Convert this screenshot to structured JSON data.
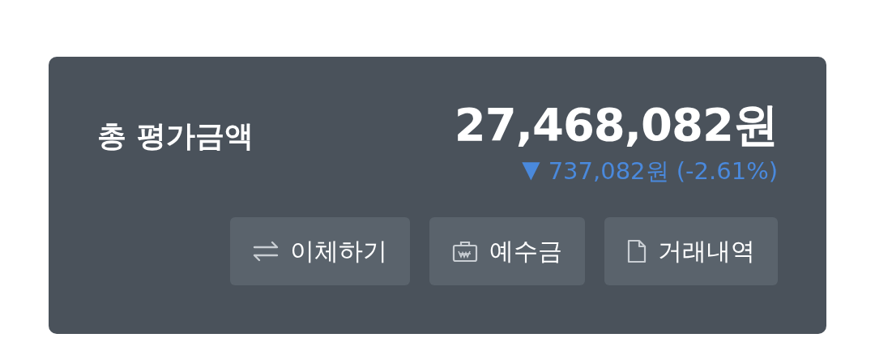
{
  "summary": {
    "title": "총 평가금액",
    "amount": "27,468,082원",
    "change": {
      "arrow": "▼",
      "text": "737,082원 (-2.61%)"
    }
  },
  "buttons": [
    {
      "label": "이체하기",
      "kind": "transfer"
    },
    {
      "label": "예수금",
      "kind": "deposit"
    },
    {
      "label": "거래내역",
      "kind": "document"
    }
  ]
}
